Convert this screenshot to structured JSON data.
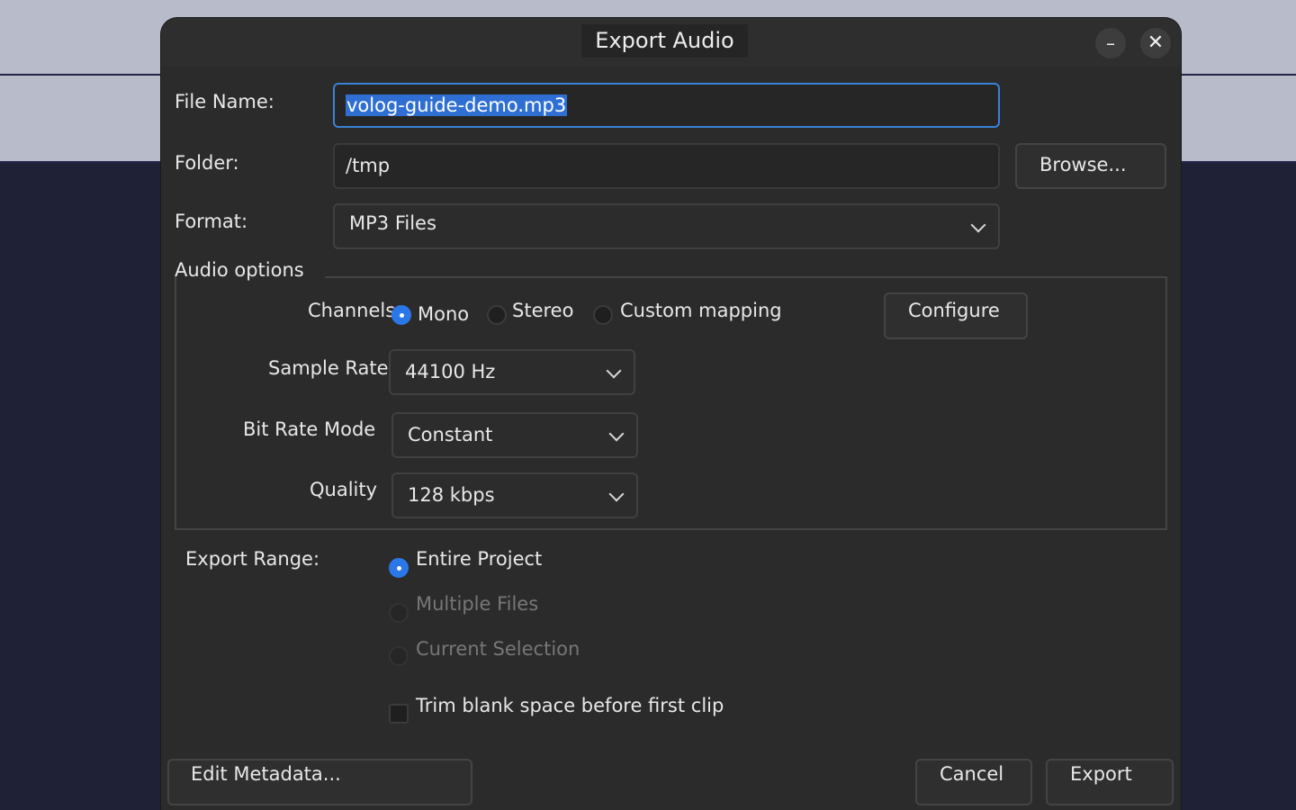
{
  "window": {
    "title": "Export Audio",
    "minimize_glyph": "–",
    "close_glyph": "✕"
  },
  "file_name": {
    "label": "File Name:",
    "value": "volog-guide-demo.mp3"
  },
  "folder": {
    "label": "Folder:",
    "value": "/tmp",
    "browse_label": "Browse..."
  },
  "format": {
    "label": "Format:",
    "selected": "MP3 Files"
  },
  "audio_options": {
    "label": "Audio options",
    "channels": {
      "label": "Channels",
      "options": [
        "Mono",
        "Stereo",
        "Custom mapping"
      ],
      "selected": "Mono",
      "configure_label": "Configure"
    },
    "sample_rate": {
      "label": "Sample Rate",
      "selected": "44100 Hz"
    },
    "bit_rate_mode": {
      "label": "Bit Rate Mode",
      "selected": "Constant"
    },
    "quality": {
      "label": "Quality",
      "selected": "128 kbps"
    }
  },
  "export_range": {
    "label": "Export Range:",
    "options": [
      "Entire Project",
      "Multiple Files",
      "Current Selection"
    ],
    "selected": "Entire Project",
    "trim_label": "Trim blank space before first clip",
    "trim_checked": false
  },
  "footer": {
    "edit_metadata_label": "Edit Metadata...",
    "cancel_label": "Cancel",
    "export_label": "Export"
  },
  "colors": {
    "accent": "#2a78e8",
    "dialog_bg": "#2b2b2b",
    "desktop_bg": "#1f2236"
  }
}
